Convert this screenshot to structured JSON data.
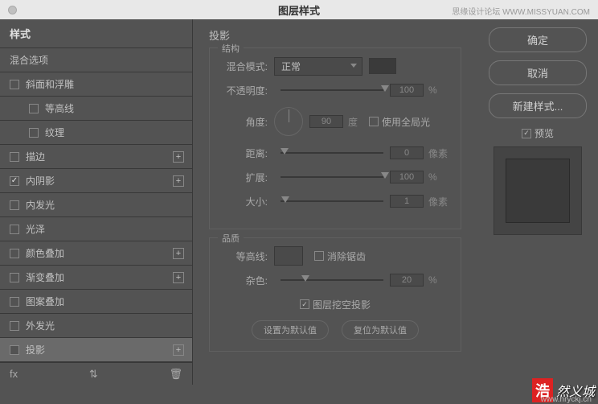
{
  "dialog": {
    "title": "图层样式"
  },
  "watermark": {
    "top": "思缘设计论坛 WWW.MISSYUAN.COM",
    "badge": "浩",
    "text": "然义城",
    "url": "www.hryckj.cn"
  },
  "left": {
    "header": "样式",
    "blend": "混合选项",
    "items": [
      {
        "label": "斜面和浮雕",
        "checked": false,
        "plus": false
      },
      {
        "label": "等高线",
        "checked": false,
        "indent": true
      },
      {
        "label": "纹理",
        "checked": false,
        "indent": true
      },
      {
        "label": "描边",
        "checked": false,
        "plus": true
      },
      {
        "label": "内阴影",
        "checked": true,
        "plus": true
      },
      {
        "label": "内发光",
        "checked": false,
        "plus": false
      },
      {
        "label": "光泽",
        "checked": false,
        "plus": false
      },
      {
        "label": "颜色叠加",
        "checked": false,
        "plus": true
      },
      {
        "label": "渐变叠加",
        "checked": false,
        "plus": true
      },
      {
        "label": "图案叠加",
        "checked": false,
        "plus": false
      },
      {
        "label": "外发光",
        "checked": false,
        "plus": false
      },
      {
        "label": "投影",
        "checked": false,
        "plus": true,
        "selected": true
      }
    ],
    "footer": {
      "fx": "fx",
      "arrows": "⇅",
      "trash": "🗑"
    }
  },
  "center": {
    "title": "投影",
    "structure": {
      "legend": "结构",
      "blendMode": {
        "label": "混合模式:",
        "value": "正常"
      },
      "opacity": {
        "label": "不透明度:",
        "value": "100",
        "unit": "%"
      },
      "angle": {
        "label": "角度:",
        "value": "90",
        "unit": "度",
        "global": "使用全局光"
      },
      "distance": {
        "label": "距离:",
        "value": "0",
        "unit": "像素"
      },
      "spread": {
        "label": "扩展:",
        "value": "100",
        "unit": "%"
      },
      "size": {
        "label": "大小:",
        "value": "1",
        "unit": "像素"
      }
    },
    "quality": {
      "legend": "品质",
      "contour": {
        "label": "等高线:",
        "antialias": "消除锯齿"
      },
      "noise": {
        "label": "杂色:",
        "value": "20",
        "unit": "%"
      },
      "knockout": "图层挖空投影",
      "setDefault": "设置为默认值",
      "resetDefault": "复位为默认值"
    }
  },
  "right": {
    "ok": "确定",
    "cancel": "取消",
    "newStyle": "新建样式...",
    "preview": "预览"
  }
}
